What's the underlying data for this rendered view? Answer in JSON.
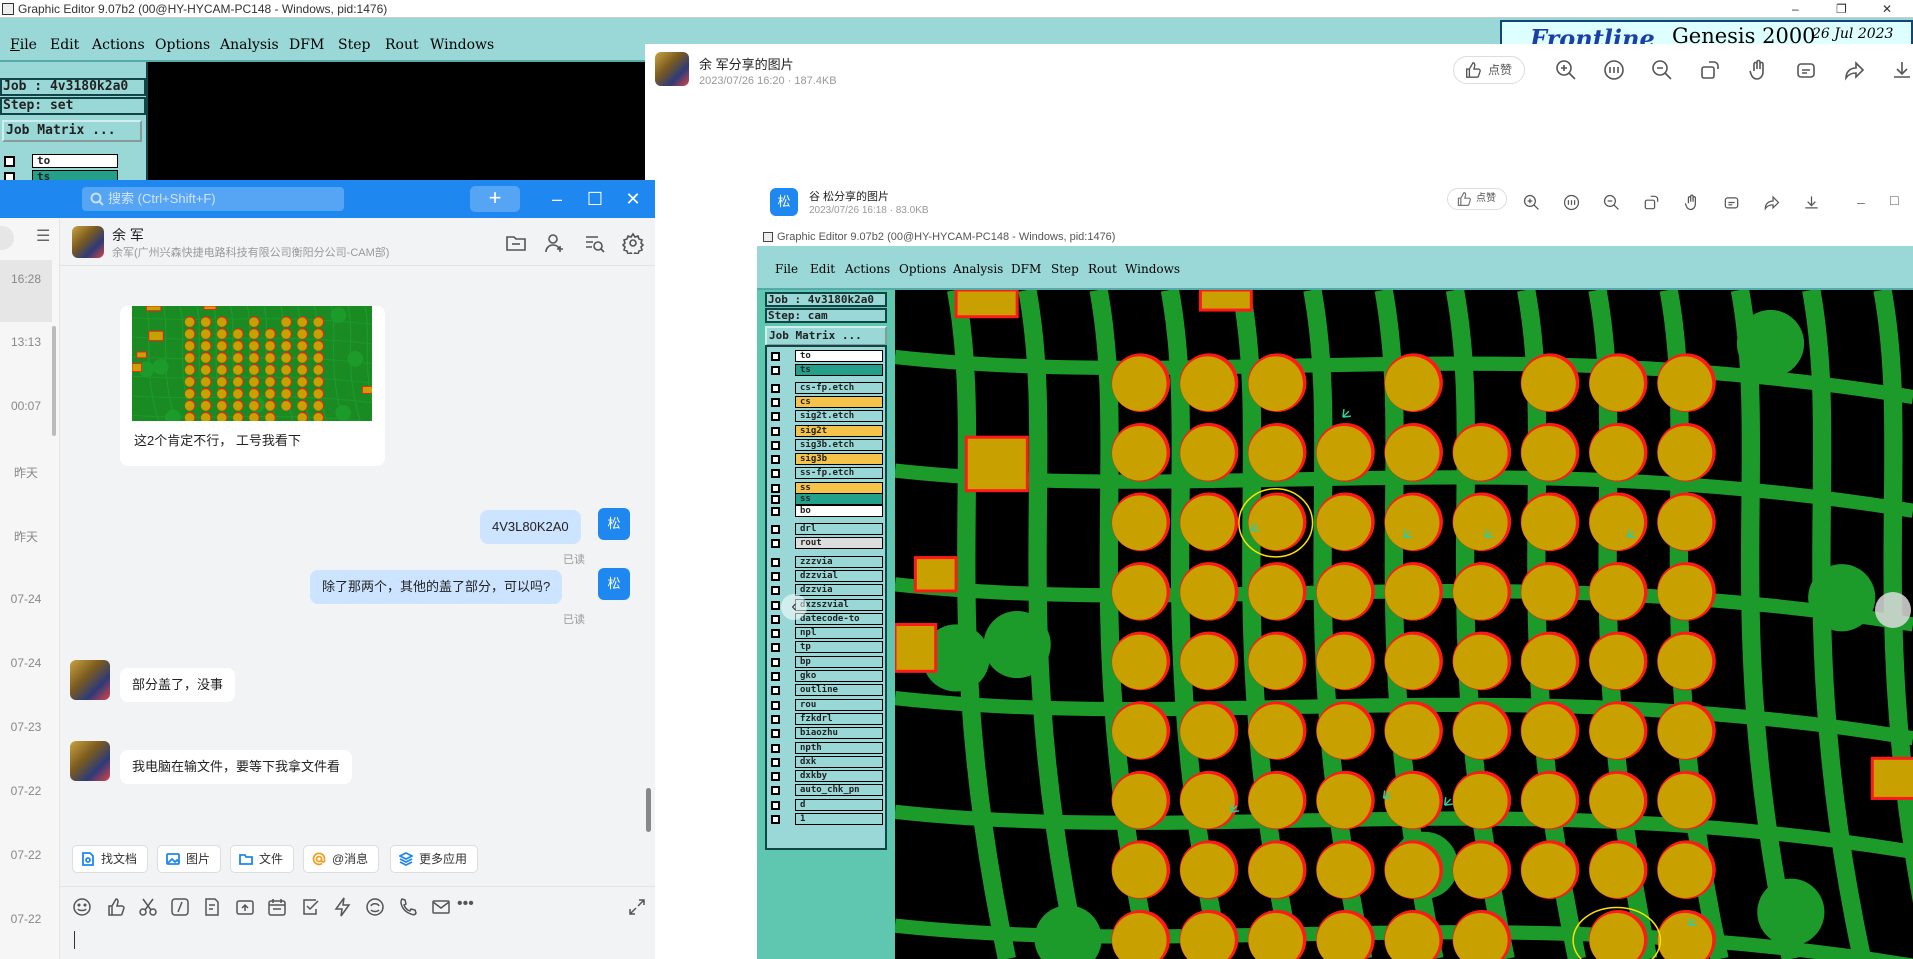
{
  "genesis": {
    "title": "Graphic Editor 9.07b2 (00@HY-HYCAM-PC148 - Windows, pid:1476)",
    "menus": [
      "File",
      "Edit",
      "Actions",
      "Options",
      "Analysis",
      "DFM",
      "Step",
      "Rout",
      "Windows"
    ],
    "menu_underlines": [
      "F",
      "E",
      "A",
      "O",
      "A",
      "D",
      "S",
      "R",
      "W"
    ],
    "job": "Job : 4v3180k2a0",
    "step": "Step: set",
    "job_matrix": "Job Matrix ...",
    "layers": [
      "to",
      "ts"
    ],
    "brand": "Frontline",
    "product": "Genesis 2000",
    "date": "26 Jul 2023",
    "window_controls": [
      "–",
      "❐",
      "✕"
    ]
  },
  "photo_viewer": {
    "sender": "余 军分享的图片",
    "meta": "2023/07/26 16:20 · 187.4KB",
    "like_label": "点赞",
    "toolbar_icons": [
      "zoom-in-icon",
      "actual-size-icon",
      "zoom-out-icon",
      "rotate-icon",
      "hand-icon",
      "ocr-icon",
      "share-icon",
      "download-icon"
    ]
  },
  "inner_viewer": {
    "avatar_text": "松",
    "sender": "谷 松分享的图片",
    "meta": "2023/07/26 16:18 · 83.0KB",
    "like_label": "点赞",
    "window_title": "Graphic Editor 9.07b2 (00@HY-HYCAM-PC148 - Windows, pid:1476)",
    "job": "Job : 4v3180k2a0",
    "step": "Step: cam",
    "job_matrix": "Job Matrix ...",
    "layers": [
      {
        "name": "to",
        "color": "#ffffff"
      },
      {
        "name": "ts",
        "color": "#23a089"
      },
      {
        "name": "cs-fp.etch",
        "color": "#9ad8d8"
      },
      {
        "name": "cs",
        "color": "#f5c24a"
      },
      {
        "name": "sig2t.etch",
        "color": "#9ad8d8"
      },
      {
        "name": "sig2t",
        "color": "#f5c24a"
      },
      {
        "name": "sig3b.etch",
        "color": "#9ad8d8"
      },
      {
        "name": "sig3b",
        "color": "#f5c24a"
      },
      {
        "name": "ss-fp.etch",
        "color": "#9ad8d8"
      },
      {
        "name": "ss",
        "color": "#f5c24a"
      },
      {
        "name": "ss",
        "color": "#23a089"
      },
      {
        "name": "bo",
        "color": "#ffffff"
      },
      {
        "name": "drl",
        "color": "#9ad8d8"
      },
      {
        "name": "rout",
        "color": "#dddddd"
      },
      {
        "name": "zzzvia",
        "color": "#9ad8d8"
      },
      {
        "name": "dzzvial",
        "color": "#9ad8d8"
      },
      {
        "name": "dzzvia",
        "color": "#9ad8d8"
      },
      {
        "name": "dxzszvial",
        "color": "#9ad8d8"
      },
      {
        "name": "datecode-to",
        "color": "#9ad8d8"
      },
      {
        "name": "npl",
        "color": "#9ad8d8"
      },
      {
        "name": "tp",
        "color": "#9ad8d8"
      },
      {
        "name": "bp",
        "color": "#9ad8d8"
      },
      {
        "name": "gko",
        "color": "#9ad8d8"
      },
      {
        "name": "outline",
        "color": "#9ad8d8"
      },
      {
        "name": "rou",
        "color": "#9ad8d8"
      },
      {
        "name": "fzkdrl",
        "color": "#9ad8d8"
      },
      {
        "name": "biaozhu",
        "color": "#9ad8d8"
      },
      {
        "name": "npth",
        "color": "#9ad8d8"
      },
      {
        "name": "dxk",
        "color": "#9ad8d8"
      },
      {
        "name": "dxkby",
        "color": "#9ad8d8"
      },
      {
        "name": "auto_chk_pn",
        "color": "#9ad8d8"
      },
      {
        "name": "d",
        "color": "#9ad8d8"
      },
      {
        "name": "1",
        "color": "#9ad8d8"
      }
    ]
  },
  "chat": {
    "search_placeholder": "搜索 (Ctrl+Shift+F)",
    "plus_label": "+",
    "contact_name": "余 军",
    "contact_sub": "余军(广州兴森快捷电路科技有限公司衡阳分公司-CAM部)",
    "side_times": [
      "16:28",
      "13:13",
      "00:07",
      "昨天",
      "昨天",
      "07-24",
      "07-24",
      "07-23",
      "07-22",
      "07-22",
      "07-22"
    ],
    "messages": [
      {
        "text": "这2个肯定不行， 工号我看下",
        "who": "other"
      },
      {
        "text": "4V3L80K2A0",
        "who": "me",
        "read": "已读"
      },
      {
        "text": "除了那两个，其他的盖了部分，可以吗?",
        "who": "me",
        "read": "已读"
      },
      {
        "text": "部分盖了，没事",
        "who": "other"
      },
      {
        "text": "我电脑在输文件，要等下我拿文件看",
        "who": "other"
      }
    ],
    "my_avatar": "松",
    "tools": [
      "找文档",
      "图片",
      "文件",
      "@消息",
      "更多应用"
    ]
  },
  "colors": {
    "accent": "#1e87f0",
    "genesis_teal": "#9ad8d8",
    "pcb_green": "#1c9a2a",
    "pad_gold": "#c8a000",
    "pad_red": "#ff1a1a"
  }
}
